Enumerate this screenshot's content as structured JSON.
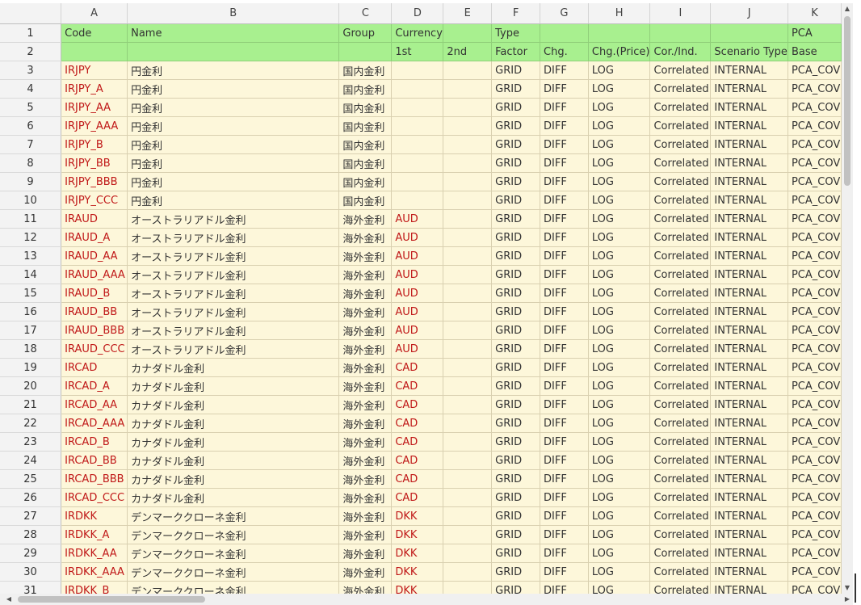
{
  "columns": [
    "A",
    "B",
    "C",
    "D",
    "E",
    "F",
    "G",
    "H",
    "I",
    "J",
    "K"
  ],
  "header_row1": [
    "Code",
    "Name",
    "Group",
    "Currency",
    "",
    "Type",
    "",
    "",
    "",
    "",
    "PCA"
  ],
  "header_row2": [
    "",
    "",
    "",
    "1st",
    "2nd",
    "Factor",
    "Chg.",
    "Chg.(Price)",
    "Cor./Ind.",
    "Scenario Type",
    "Base"
  ],
  "rows": [
    [
      "IRJPY",
      "円金利",
      "国内金利",
      "",
      "",
      "GRID",
      "DIFF",
      "LOG",
      "Correlated",
      "INTERNAL",
      "PCA_COV"
    ],
    [
      "IRJPY_A",
      "円金利",
      "国内金利",
      "",
      "",
      "GRID",
      "DIFF",
      "LOG",
      "Correlated",
      "INTERNAL",
      "PCA_COV"
    ],
    [
      "IRJPY_AA",
      "円金利",
      "国内金利",
      "",
      "",
      "GRID",
      "DIFF",
      "LOG",
      "Correlated",
      "INTERNAL",
      "PCA_COV"
    ],
    [
      "IRJPY_AAA",
      "円金利",
      "国内金利",
      "",
      "",
      "GRID",
      "DIFF",
      "LOG",
      "Correlated",
      "INTERNAL",
      "PCA_COV"
    ],
    [
      "IRJPY_B",
      "円金利",
      "国内金利",
      "",
      "",
      "GRID",
      "DIFF",
      "LOG",
      "Correlated",
      "INTERNAL",
      "PCA_COV"
    ],
    [
      "IRJPY_BB",
      "円金利",
      "国内金利",
      "",
      "",
      "GRID",
      "DIFF",
      "LOG",
      "Correlated",
      "INTERNAL",
      "PCA_COV"
    ],
    [
      "IRJPY_BBB",
      "円金利",
      "国内金利",
      "",
      "",
      "GRID",
      "DIFF",
      "LOG",
      "Correlated",
      "INTERNAL",
      "PCA_COV"
    ],
    [
      "IRJPY_CCC",
      "円金利",
      "国内金利",
      "",
      "",
      "GRID",
      "DIFF",
      "LOG",
      "Correlated",
      "INTERNAL",
      "PCA_COV"
    ],
    [
      "IRAUD",
      "オーストラリアドル金利",
      "海外金利",
      "AUD",
      "",
      "GRID",
      "DIFF",
      "LOG",
      "Correlated",
      "INTERNAL",
      "PCA_COV"
    ],
    [
      "IRAUD_A",
      "オーストラリアドル金利",
      "海外金利",
      "AUD",
      "",
      "GRID",
      "DIFF",
      "LOG",
      "Correlated",
      "INTERNAL",
      "PCA_COV"
    ],
    [
      "IRAUD_AA",
      "オーストラリアドル金利",
      "海外金利",
      "AUD",
      "",
      "GRID",
      "DIFF",
      "LOG",
      "Correlated",
      "INTERNAL",
      "PCA_COV"
    ],
    [
      "IRAUD_AAA",
      "オーストラリアドル金利",
      "海外金利",
      "AUD",
      "",
      "GRID",
      "DIFF",
      "LOG",
      "Correlated",
      "INTERNAL",
      "PCA_COV"
    ],
    [
      "IRAUD_B",
      "オーストラリアドル金利",
      "海外金利",
      "AUD",
      "",
      "GRID",
      "DIFF",
      "LOG",
      "Correlated",
      "INTERNAL",
      "PCA_COV"
    ],
    [
      "IRAUD_BB",
      "オーストラリアドル金利",
      "海外金利",
      "AUD",
      "",
      "GRID",
      "DIFF",
      "LOG",
      "Correlated",
      "INTERNAL",
      "PCA_COV"
    ],
    [
      "IRAUD_BBB",
      "オーストラリアドル金利",
      "海外金利",
      "AUD",
      "",
      "GRID",
      "DIFF",
      "LOG",
      "Correlated",
      "INTERNAL",
      "PCA_COV"
    ],
    [
      "IRAUD_CCC",
      "オーストラリアドル金利",
      "海外金利",
      "AUD",
      "",
      "GRID",
      "DIFF",
      "LOG",
      "Correlated",
      "INTERNAL",
      "PCA_COV"
    ],
    [
      "IRCAD",
      "カナダドル金利",
      "海外金利",
      "CAD",
      "",
      "GRID",
      "DIFF",
      "LOG",
      "Correlated",
      "INTERNAL",
      "PCA_COV"
    ],
    [
      "IRCAD_A",
      "カナダドル金利",
      "海外金利",
      "CAD",
      "",
      "GRID",
      "DIFF",
      "LOG",
      "Correlated",
      "INTERNAL",
      "PCA_COV"
    ],
    [
      "IRCAD_AA",
      "カナダドル金利",
      "海外金利",
      "CAD",
      "",
      "GRID",
      "DIFF",
      "LOG",
      "Correlated",
      "INTERNAL",
      "PCA_COV"
    ],
    [
      "IRCAD_AAA",
      "カナダドル金利",
      "海外金利",
      "CAD",
      "",
      "GRID",
      "DIFF",
      "LOG",
      "Correlated",
      "INTERNAL",
      "PCA_COV"
    ],
    [
      "IRCAD_B",
      "カナダドル金利",
      "海外金利",
      "CAD",
      "",
      "GRID",
      "DIFF",
      "LOG",
      "Correlated",
      "INTERNAL",
      "PCA_COV"
    ],
    [
      "IRCAD_BB",
      "カナダドル金利",
      "海外金利",
      "CAD",
      "",
      "GRID",
      "DIFF",
      "LOG",
      "Correlated",
      "INTERNAL",
      "PCA_COV"
    ],
    [
      "IRCAD_BBB",
      "カナダドル金利",
      "海外金利",
      "CAD",
      "",
      "GRID",
      "DIFF",
      "LOG",
      "Correlated",
      "INTERNAL",
      "PCA_COV"
    ],
    [
      "IRCAD_CCC",
      "カナダドル金利",
      "海外金利",
      "CAD",
      "",
      "GRID",
      "DIFF",
      "LOG",
      "Correlated",
      "INTERNAL",
      "PCA_COV"
    ],
    [
      "IRDKK",
      "デンマーククローネ金利",
      "海外金利",
      "DKK",
      "",
      "GRID",
      "DIFF",
      "LOG",
      "Correlated",
      "INTERNAL",
      "PCA_COV"
    ],
    [
      "IRDKK_A",
      "デンマーククローネ金利",
      "海外金利",
      "DKK",
      "",
      "GRID",
      "DIFF",
      "LOG",
      "Correlated",
      "INTERNAL",
      "PCA_COV"
    ],
    [
      "IRDKK_AA",
      "デンマーククローネ金利",
      "海外金利",
      "DKK",
      "",
      "GRID",
      "DIFF",
      "LOG",
      "Correlated",
      "INTERNAL",
      "PCA_COV"
    ],
    [
      "IRDKK_AAA",
      "デンマーククローネ金利",
      "海外金利",
      "DKK",
      "",
      "GRID",
      "DIFF",
      "LOG",
      "Correlated",
      "INTERNAL",
      "PCA_COV"
    ],
    [
      "IRDKK_B",
      "デンマーククローネ金利",
      "海外金利",
      "DKK",
      "",
      "GRID",
      "DIFF",
      "LOG",
      "Correlated",
      "INTERNAL",
      "PCA_COV"
    ]
  ],
  "colors": {
    "header_green": "#a8f08f",
    "data_cell": "#fdf7da",
    "red_text": "#c01818"
  },
  "icons": {
    "scroll_up": "triangle-up-icon",
    "scroll_down": "triangle-down-icon",
    "scroll_left": "triangle-left-icon",
    "scroll_right": "triangle-right-icon"
  }
}
